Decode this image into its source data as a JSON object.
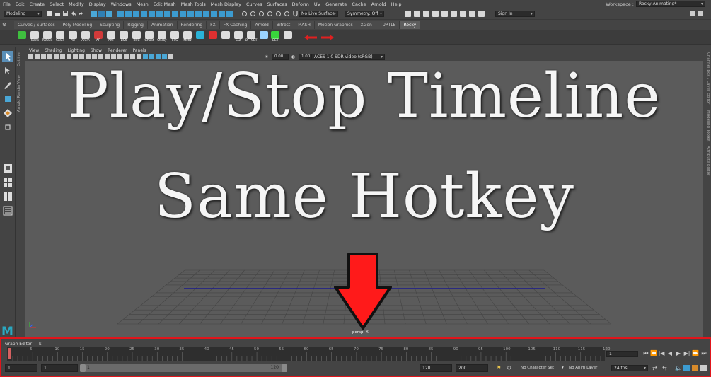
{
  "menubar": {
    "items": [
      "File",
      "Edit",
      "Create",
      "Select",
      "Modify",
      "Display",
      "Windows",
      "Mesh",
      "Edit Mesh",
      "Mesh Tools",
      "Mesh Display",
      "Curves",
      "Surfaces",
      "Deform",
      "UV",
      "Generate",
      "Cache",
      "Arnold",
      "Help"
    ],
    "workspace_label": "Workspace :",
    "workspace_value": "Rocky Animating*"
  },
  "statusline": {
    "mode_value": "Modeling",
    "live_surface": "No Live Surface",
    "symmetry": "Symmetry: Off",
    "sign_in": "Sign In"
  },
  "shelf": {
    "tabs": [
      "Curves / Surfaces",
      "Poly Modeling",
      "Sculpting",
      "Rigging",
      "Animation",
      "Rendering",
      "FX",
      "FX Caching",
      "Arnold",
      "Bifrost",
      "MASH",
      "Motion Graphics",
      "XGen",
      "TURTLE",
      "Rocky"
    ],
    "active_tab": 14,
    "icons": [
      {
        "label": "",
        "color": "#3fbf3f"
      },
      {
        "label": "Trans",
        "color": "#dddddd"
      },
      {
        "label": "Rotate",
        "color": "#dddddd"
      },
      {
        "label": "Scale",
        "color": "#dddddd"
      },
      {
        "label": "All",
        "color": "#dddddd"
      },
      {
        "label": "Anim",
        "color": "#dddddd"
      },
      {
        "label": "AR",
        "color": "#d23a3a"
      },
      {
        "label": "AKT",
        "color": "#dddddd"
      },
      {
        "label": "BSK",
        "color": "#dddddd"
      },
      {
        "label": "BSC",
        "color": "#dddddd"
      },
      {
        "label": "Ghost",
        "color": "#dddddd"
      },
      {
        "label": "Sticky",
        "color": "#dddddd"
      },
      {
        "label": "FPS",
        "color": "#dddddd"
      },
      {
        "label": "MMD",
        "color": "#dddddd"
      },
      {
        "label": "",
        "color": "#2ab3d8"
      },
      {
        "label": "",
        "color": "#e03030"
      },
      {
        "label": "",
        "color": "#dddddd"
      },
      {
        "label": "Cut",
        "color": "#dddddd"
      },
      {
        "label": "OFFSET",
        "color": "#dddddd"
      },
      {
        "label": "",
        "color": "#9ad3ff"
      },
      {
        "label": "GET",
        "color": "#39d43c"
      },
      {
        "label": "",
        "color": "#dddddd"
      }
    ]
  },
  "panel": {
    "menus": [
      "View",
      "Shading",
      "Lighting",
      "Show",
      "Renderer",
      "Panels"
    ],
    "exposure": "0.00",
    "gamma": "1.00",
    "color_space": "ACES 1.0 SDR-video (sRGB)"
  },
  "left_strip": {
    "labels": [
      "Outliner",
      "Arnold RenderView"
    ]
  },
  "right_strip": {
    "labels": [
      "Channel Box / Layer Editor",
      "Modeling Toolkit",
      "Attribute Editor"
    ]
  },
  "viewport": {
    "title_line1": "Play/Stop Timeline",
    "title_line2": "Same Hotkey",
    "camera_label": "persp -X",
    "logo": "M"
  },
  "timeline": {
    "graph_editor_label": "Graph Editor",
    "separator": "k",
    "ticks": [
      "5",
      "10",
      "15",
      "20",
      "25",
      "30",
      "35",
      "40",
      "45",
      "50",
      "55",
      "60",
      "65",
      "70",
      "75",
      "80",
      "85",
      "90",
      "95",
      "100",
      "105",
      "110",
      "115",
      "120"
    ],
    "current_frame": "1",
    "range": {
      "start": "1",
      "playback_start": "1",
      "bar_start": "1",
      "bar_end": "120",
      "playback_end": "120",
      "end": "200"
    },
    "character_set": "No Character Set",
    "anim_layer": "No Anim Layer",
    "fps": "24 fps"
  },
  "colors": {
    "highlight_red": "#e0151b",
    "grid_line": "#444444",
    "axis_blue": "#1a1a8c",
    "viewport_bg": "#5b5b5b"
  }
}
